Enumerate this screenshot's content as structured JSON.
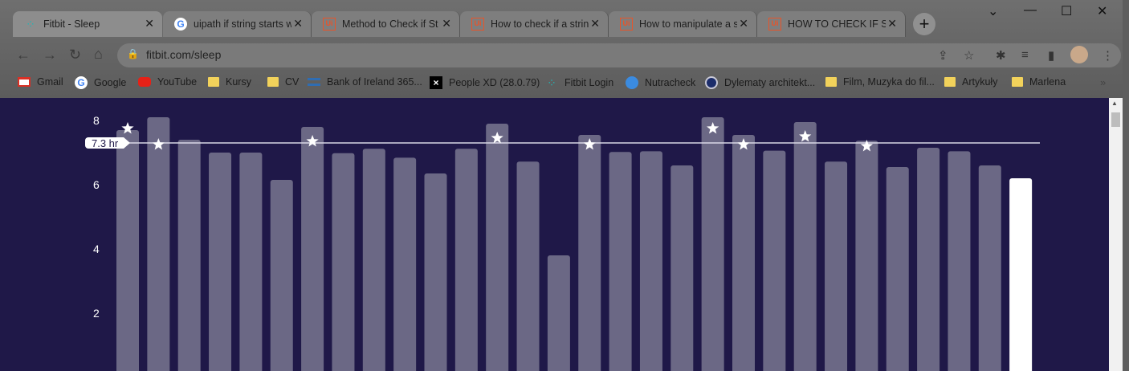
{
  "tabs": [
    {
      "title": "Fitbit - Sleep",
      "icon": "fitbit-icon",
      "active": true
    },
    {
      "title": "uipath if string starts w",
      "icon": "google-icon",
      "active": false
    },
    {
      "title": "Method to Check if St",
      "icon": "uipath-icon",
      "active": false
    },
    {
      "title": "How to check if a strin",
      "icon": "uipath-icon",
      "active": false
    },
    {
      "title": "How to manipulate a s",
      "icon": "uipath-icon",
      "active": false
    },
    {
      "title": "HOW TO CHECK IF ST",
      "icon": "uipath-icon",
      "active": false
    }
  ],
  "tab_close_glyph": "✕",
  "new_tab_glyph": "+",
  "window_controls": {
    "tab_search": "⌄",
    "minimize": "—",
    "maximize": "☐",
    "close": "✕"
  },
  "toolbar": {
    "back": "←",
    "forward": "→",
    "reload": "↻",
    "home": "⌂",
    "lock": "🔒",
    "url": "fitbit.com/sleep",
    "share": "⇪",
    "bookmark_star": "☆",
    "extensions": "✱",
    "media": "≡",
    "side_panel": "▮",
    "menu": "⋮"
  },
  "bookmarks": [
    {
      "label": "Gmail",
      "icon": "gmail-icon"
    },
    {
      "label": "Google",
      "icon": "google-icon"
    },
    {
      "label": "YouTube",
      "icon": "youtube-icon"
    },
    {
      "label": "Kursy",
      "icon": "folder-icon"
    },
    {
      "label": "CV",
      "icon": "folder-icon"
    },
    {
      "label": "Bank of Ireland 365...",
      "icon": "bank-icon"
    },
    {
      "label": "People XD (28.0.79)",
      "icon": "x-icon"
    },
    {
      "label": "Fitbit Login",
      "icon": "fitbit-icon"
    },
    {
      "label": "Nutracheck",
      "icon": "globe-icon"
    },
    {
      "label": "Dylematy architekt...",
      "icon": "badge-icon"
    },
    {
      "label": "Film, Muzyka do fil...",
      "icon": "folder-icon"
    },
    {
      "label": "Artykuły",
      "icon": "folder-icon"
    },
    {
      "label": "Marlena",
      "icon": "folder-icon"
    }
  ],
  "bookmarks_overflow": "»",
  "colors": {
    "page_bg": "#1f1848",
    "bar": "#6b6885",
    "bar_today": "#ffffff",
    "avg_line": "#d9d7e6",
    "star": "#ffffff"
  },
  "chart_data": {
    "type": "bar",
    "ylabel": "",
    "y_ticks": [
      8,
      6,
      4,
      2
    ],
    "ylim": [
      0,
      8.8
    ],
    "average": 7.3,
    "average_label": "7.3 hr",
    "values": [
      7.7,
      8.1,
      7.4,
      7.0,
      7.0,
      6.15,
      7.8,
      6.98,
      7.12,
      6.84,
      6.35,
      7.12,
      7.9,
      6.72,
      3.8,
      7.55,
      7.02,
      7.04,
      6.6,
      8.1,
      7.55,
      7.06,
      7.95,
      6.72,
      7.37,
      6.55,
      7.15,
      7.04,
      6.6,
      6.2
    ],
    "star_values": [
      7.75,
      7.25,
      null,
      null,
      null,
      null,
      7.35,
      null,
      null,
      null,
      null,
      null,
      7.45,
      null,
      null,
      7.25,
      null,
      null,
      null,
      7.75,
      7.25,
      null,
      7.5,
      null,
      7.2,
      null,
      null,
      null,
      null,
      null
    ],
    "highlight_last": true
  }
}
